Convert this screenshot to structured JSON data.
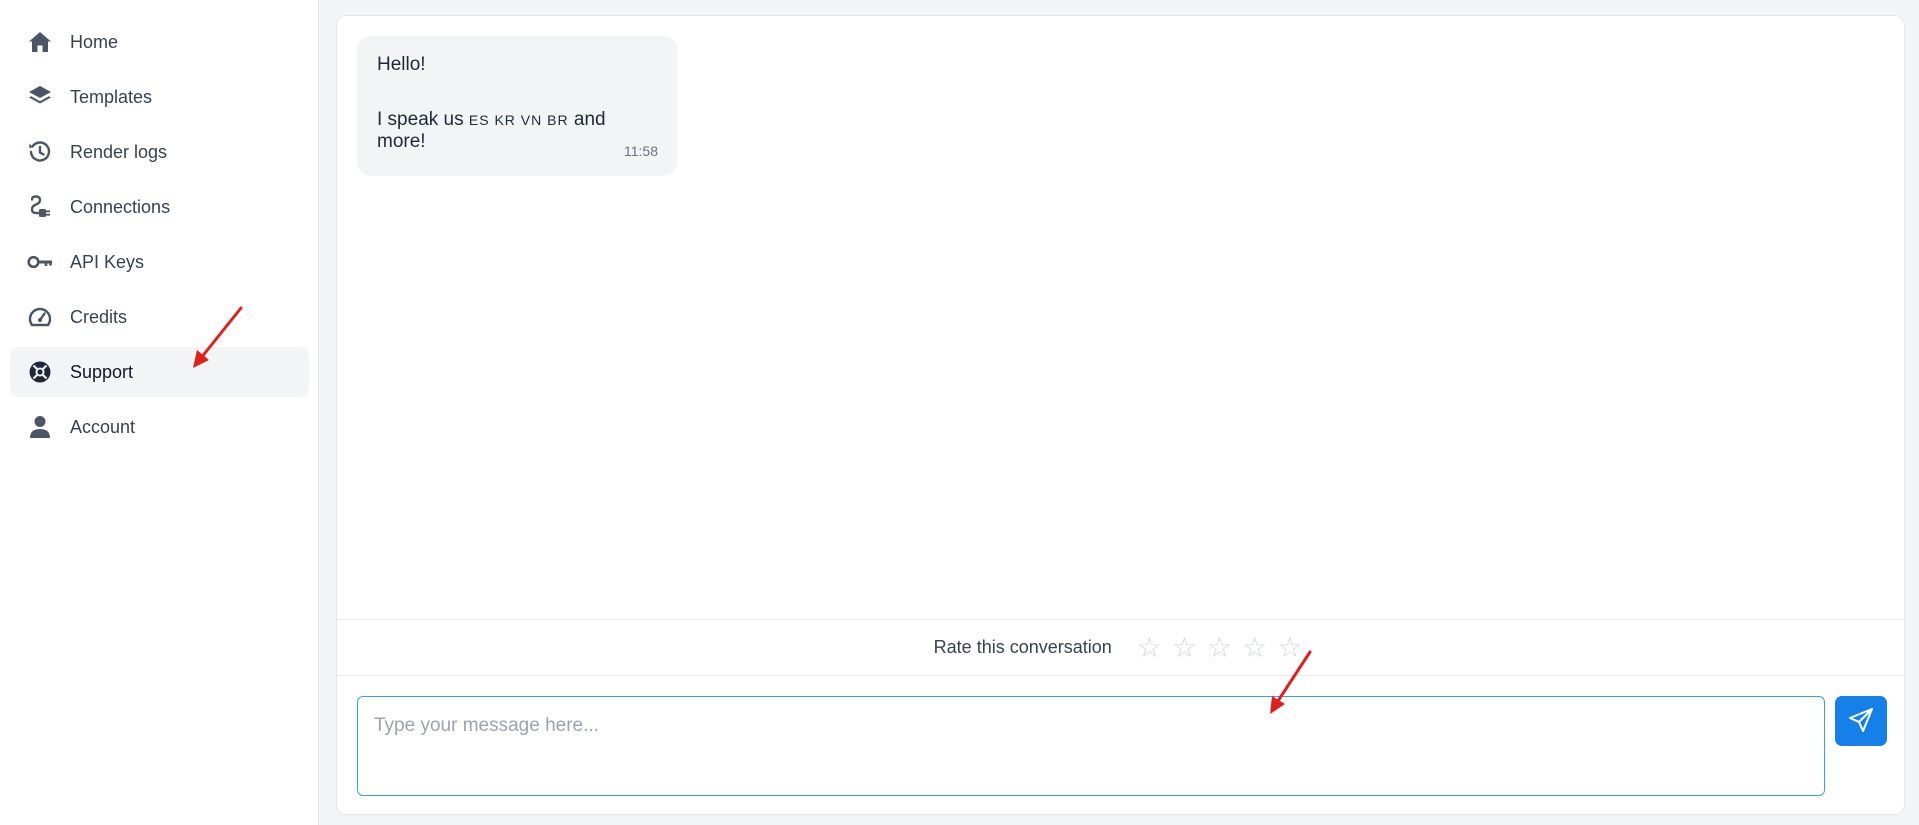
{
  "sidebar": {
    "items": [
      {
        "label": "Home",
        "icon": "home-icon"
      },
      {
        "label": "Templates",
        "icon": "layers-icon"
      },
      {
        "label": "Render logs",
        "icon": "history-icon"
      },
      {
        "label": "Connections",
        "icon": "plug-icon"
      },
      {
        "label": "API Keys",
        "icon": "key-icon"
      },
      {
        "label": "Credits",
        "icon": "gauge-icon"
      },
      {
        "label": "Support",
        "icon": "lifebuoy-icon",
        "active": true
      },
      {
        "label": "Account",
        "icon": "user-icon"
      }
    ]
  },
  "chat": {
    "messages": [
      {
        "greeting": "Hello!",
        "text_before_flags": "I speak us ",
        "flags": "ES KR VN BR",
        "text_after_flags": " and more!",
        "time": "11:58"
      }
    ],
    "rating": {
      "label": "Rate this conversation",
      "stars": 5,
      "value": 0
    },
    "input": {
      "placeholder": "Type your message here...",
      "value": ""
    }
  },
  "colors": {
    "accent": "#1480e8",
    "annotation_arrow": "#e0201a"
  }
}
